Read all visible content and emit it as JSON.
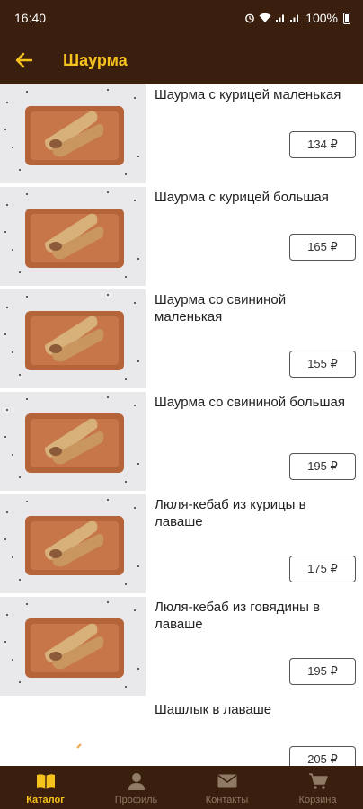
{
  "status_bar": {
    "time": "16:40",
    "battery": "100%"
  },
  "header": {
    "title": "Шаурма",
    "back_icon": "arrow-left-icon"
  },
  "items": [
    {
      "name": "Шаурма с курицей маленькая",
      "price": "134 ₽"
    },
    {
      "name": "Шаурма с курицей большая",
      "price": "165 ₽"
    },
    {
      "name": "Шаурма со свининой маленькая",
      "price": "155 ₽"
    },
    {
      "name": "Шаурма со свининой большая",
      "price": "195 ₽"
    },
    {
      "name": "Люля-кебаб из курицы в лаваше",
      "price": "175 ₽"
    },
    {
      "name": "Люля-кебаб из говядины в лаваше",
      "price": "195 ₽"
    },
    {
      "name": "Шашлык в лаваше",
      "price": "205 ₽"
    }
  ],
  "bottom_nav": [
    {
      "label": "Каталог",
      "icon": "book-icon",
      "active": true
    },
    {
      "label": "Профиль",
      "icon": "person-icon",
      "active": false
    },
    {
      "label": "Контакты",
      "icon": "envelope-icon",
      "active": false
    },
    {
      "label": "Корзина",
      "icon": "cart-icon",
      "active": false
    }
  ],
  "colors": {
    "header_bg": "#3a1f0e",
    "accent": "#f6c21c",
    "nav_inactive": "#8f7a66"
  }
}
